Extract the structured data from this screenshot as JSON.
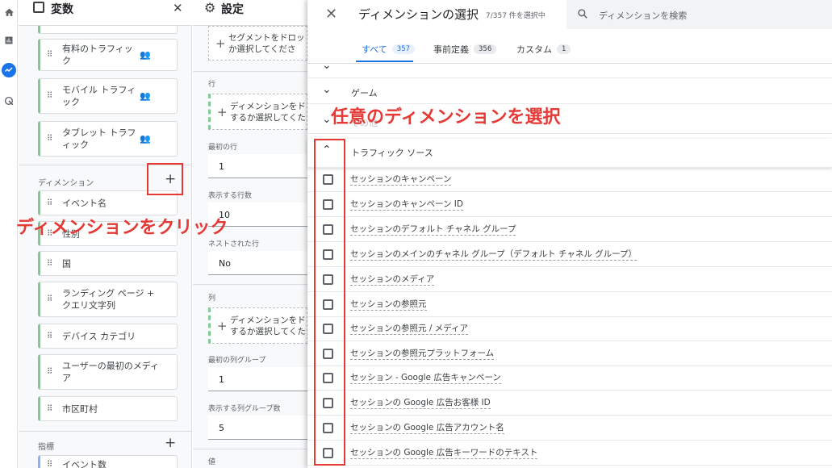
{
  "rail": {
    "icons": [
      "home-icon",
      "reports-icon",
      "explore-icon",
      "advertising-icon"
    ]
  },
  "variables": {
    "title": "変数",
    "close": "✕",
    "segments": [
      {
        "label": "有料のトラフィック"
      },
      {
        "label": "モバイル トラフィック"
      },
      {
        "label": "タブレット トラフィック"
      }
    ],
    "dimensions_label": "ディメンション",
    "add": "+",
    "dimensions": [
      "イベント名",
      "性別",
      "国",
      "ランディング ページ + クエリ文字列",
      "デバイス カテゴリ",
      "ユーザーの最初のメディア",
      "市区町村"
    ],
    "metrics_label": "指標",
    "metrics": [
      "イベント数"
    ]
  },
  "settings": {
    "title": "設定",
    "segment_drop": "セグメントをドロッか選択してくださ",
    "segment_drop_l1": "セグメントをドロッ",
    "segment_drop_l2": "か選択してくださ",
    "rows_label": "行",
    "rows_drop_l1": "ディメンションをド",
    "rows_drop_l2": "するか選択してくた",
    "first_row_label": "最初の行",
    "first_row_value": "1",
    "rows_shown_label": "表示する行数",
    "rows_shown_value": "10",
    "nested_label": "ネストされた行",
    "nested_value": "No",
    "cols_label": "列",
    "cols_drop_l1": "ディメンションをド",
    "cols_drop_l2": "するか選択してくた",
    "first_col_label": "最初の列グループ",
    "first_col_value": "1",
    "col_groups_label": "表示する列グループ数",
    "col_groups_value": "5",
    "values_label": "値"
  },
  "dialog": {
    "close": "✕",
    "title": "ディメンションの選択",
    "count": "7/357 件を選択中",
    "search_placeholder": "ディメンションを検索",
    "tabs": [
      {
        "label": "すべて",
        "count": "357"
      },
      {
        "label": "事前定義",
        "count": "356"
      },
      {
        "label": "カスタム",
        "count": "1"
      }
    ],
    "groups": [
      "ゲーム",
      "その他",
      "トラフィック ソース"
    ],
    "options": [
      "セッションのキャンペーン",
      "セッションのキャンペーン ID",
      "セッションのデフォルト チャネル グループ",
      "セッションのメインのチャネル グループ（デフォルト チャネル グループ）",
      "セッションのメディア",
      "セッションの参照元",
      "セッションの参照元 / メディア",
      "セッションの参照元プラットフォーム",
      "セッション - Google 広告キャンペーン",
      "セッションの Google 広告お客様 ID",
      "セッションの Google 広告アカウント名",
      "セッションの Google 広告キーワードのテキスト"
    ]
  },
  "annotations": {
    "click_dimension": "ディメンションをクリック",
    "select_dimension": "任意のディメンションを選択",
    "color": "#e53935"
  }
}
